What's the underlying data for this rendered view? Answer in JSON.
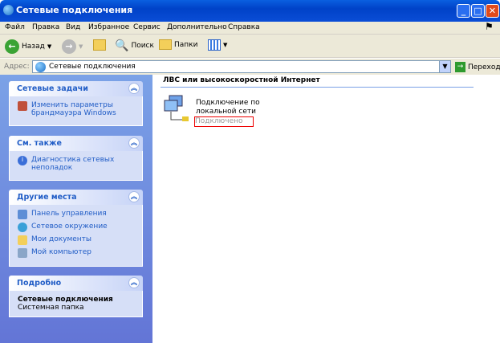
{
  "window": {
    "title": "Сетевые подключения"
  },
  "menu": [
    "Файл",
    "Правка",
    "Вид",
    "Избранное",
    "Сервис",
    "Дополнительно",
    "Справка"
  ],
  "toolbar": {
    "back": "Назад",
    "search": "Поиск",
    "folders": "Папки"
  },
  "address": {
    "label": "Адрес:",
    "value": "Сетевые подключения",
    "go": "Переход"
  },
  "panels": [
    {
      "title": "Сетевые задачи",
      "items": [
        "Изменить параметры брандмауэра Windows"
      ]
    },
    {
      "title": "См. также",
      "items": [
        "Диагностика сетевых неполадок"
      ]
    },
    {
      "title": "Другие места",
      "items": [
        "Панель управления",
        "Сетевое окружение",
        "Мои документы",
        "Мой компьютер"
      ]
    },
    {
      "title": "Подробно",
      "details_name": "Сетевые подключения",
      "details_type": "Системная папка"
    }
  ],
  "main": {
    "section": "ЛВС или высокоскоростной Интернет",
    "connection": {
      "name": "Подключение по локальной сети",
      "status": "Подключено"
    }
  }
}
